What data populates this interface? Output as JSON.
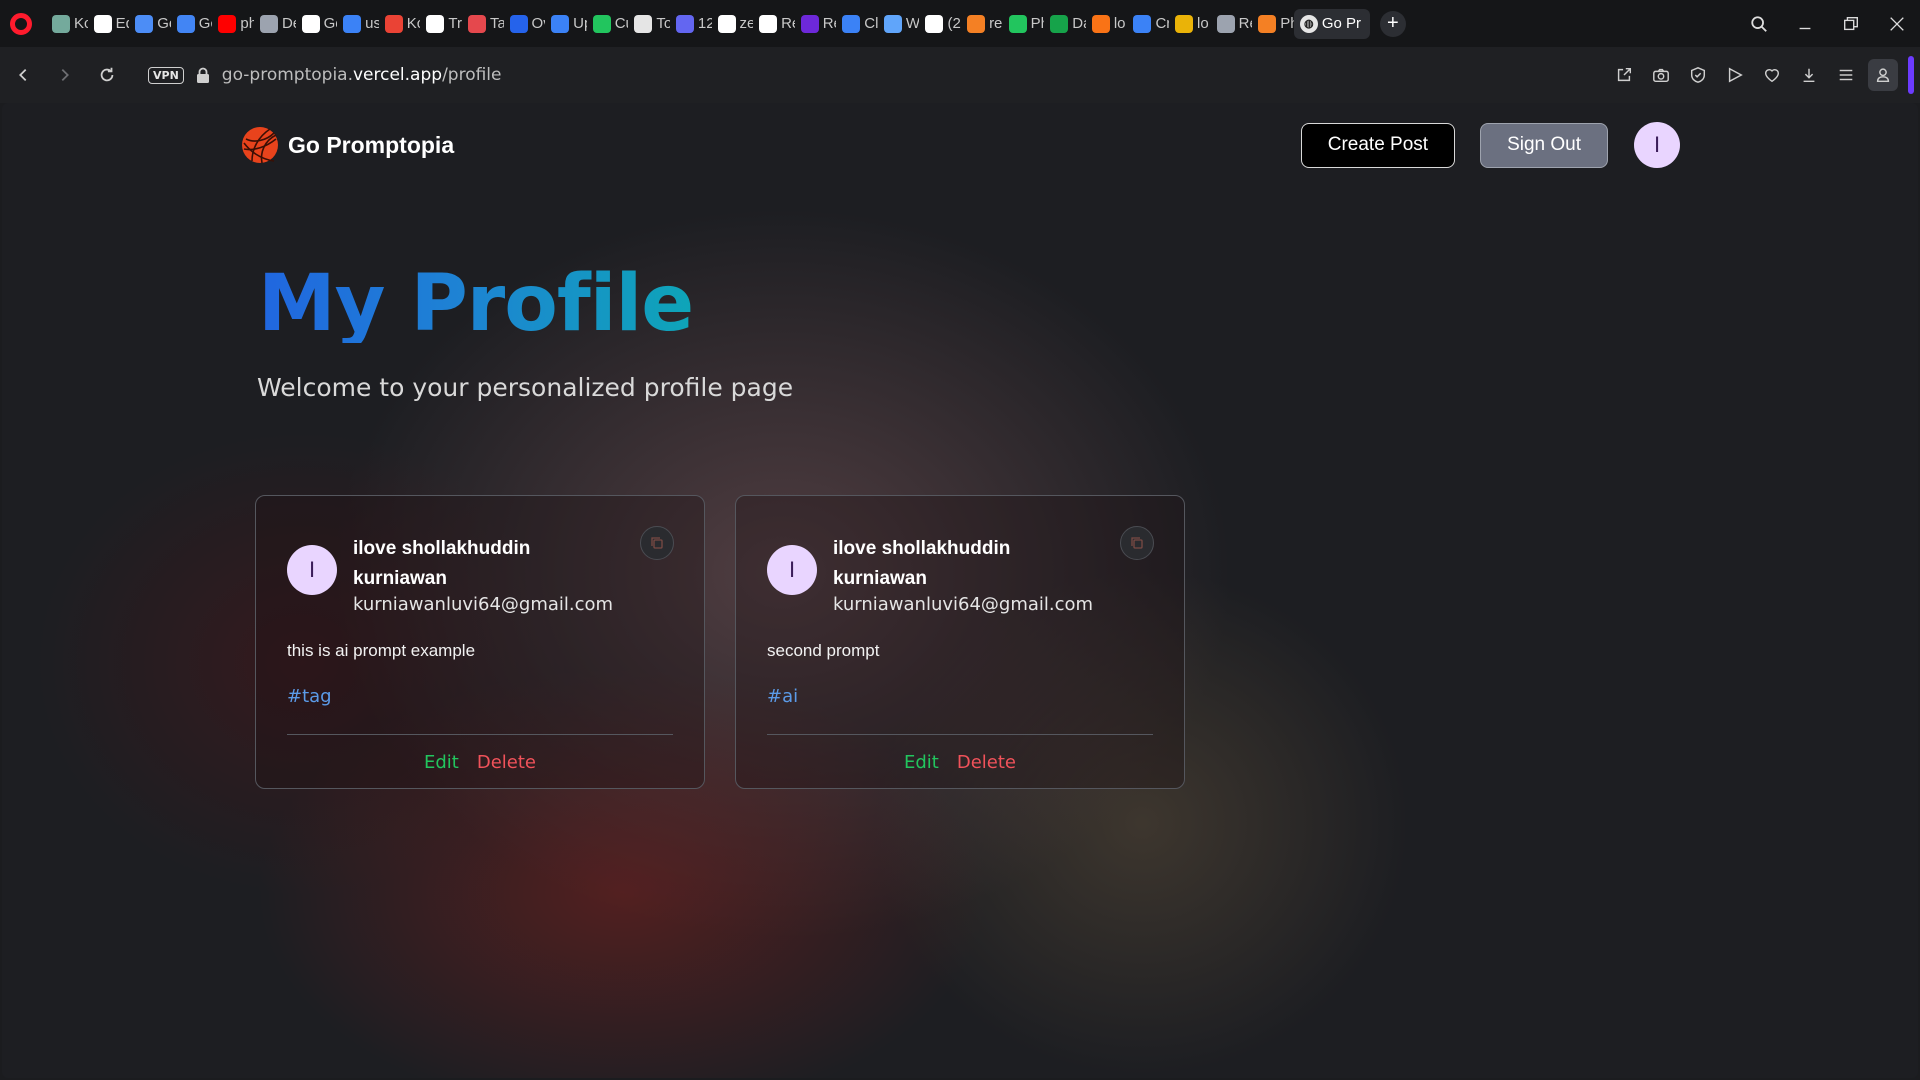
{
  "browser": {
    "tabs": [
      {
        "label": "Kc",
        "icon": "chatgpt-icon",
        "color": "#74aa9c"
      },
      {
        "label": "Ed",
        "icon": "github-icon",
        "color": "#ffffff"
      },
      {
        "label": "Ge",
        "icon": "gemini-icon",
        "color": "#4c8df6"
      },
      {
        "label": "Gc",
        "icon": "google-translate-icon",
        "color": "#4285f4"
      },
      {
        "label": "ph",
        "icon": "youtube-icon",
        "color": "#ff0000"
      },
      {
        "label": "De",
        "icon": "dev-avatar-icon",
        "color": "#9ca3af"
      },
      {
        "label": "Ge",
        "icon": "notion-n-icon",
        "color": "#ffffff"
      },
      {
        "label": "us",
        "icon": "openai-icon",
        "color": "#3b82f6"
      },
      {
        "label": "Kc",
        "icon": "gmail-icon",
        "color": "#ea4335"
      },
      {
        "label": "Tr",
        "icon": "framer-icon",
        "color": "#ffffff"
      },
      {
        "label": "Ta",
        "icon": "t-icon",
        "color": "#e5484d"
      },
      {
        "label": "Ov",
        "icon": "shield-icon",
        "color": "#2563eb"
      },
      {
        "label": "Up",
        "icon": "upwork-icon",
        "color": "#3b82f6"
      },
      {
        "label": "Cu",
        "icon": "copilot-icon",
        "color": "#22c55e"
      },
      {
        "label": "To",
        "icon": "pin-icon",
        "color": "#e5e5e5"
      },
      {
        "label": "12",
        "icon": "globe-icon",
        "color": "#6366f1"
      },
      {
        "label": "ze",
        "icon": "github-icon",
        "color": "#ffffff"
      },
      {
        "label": "Re",
        "icon": "react-icon",
        "color": "#ffffff"
      },
      {
        "label": "Re",
        "icon": "ryu-icon",
        "color": "#6d28d9"
      },
      {
        "label": "Cl",
        "icon": "cloud-icon",
        "color": "#3b82f6"
      },
      {
        "label": "W",
        "icon": "check-icon",
        "color": "#60a5fa"
      },
      {
        "label": "(2",
        "icon": "notion-icon",
        "color": "#ffffff"
      },
      {
        "label": "re",
        "icon": "stack-icon",
        "color": "#f48024"
      },
      {
        "label": "Ph",
        "icon": "w-icon",
        "color": "#22c55e"
      },
      {
        "label": "Da",
        "icon": "mongodb-icon",
        "color": "#16a34a"
      },
      {
        "label": "lo",
        "icon": "box-icon",
        "color": "#f97316"
      },
      {
        "label": "Cr",
        "icon": "api-icon",
        "color": "#3b82f6"
      },
      {
        "label": "lo",
        "icon": "mountain-icon",
        "color": "#eab308"
      },
      {
        "label": "Re",
        "icon": "book-icon",
        "color": "#9ca3af"
      },
      {
        "label": "Ph",
        "icon": "stack-icon",
        "color": "#f48024"
      }
    ],
    "active_tab": {
      "label": "Go Pr",
      "icon": "globe-icon"
    },
    "url_host": "go-promptopia.",
    "url_domain": "vercel.app",
    "url_path": "/profile",
    "vpn_label": "VPN"
  },
  "nav": {
    "brand": "Go Promptopia",
    "create_label": "Create Post",
    "signout_label": "Sign Out",
    "avatar_initial": "I"
  },
  "page": {
    "title": "My Profile",
    "subtitle": "Welcome to your personalized profile page"
  },
  "posts": [
    {
      "avatar_initial": "I",
      "name": "ilove shollakhuddin kurniawan",
      "email": "kurniawanluvi64@gmail.com",
      "prompt": "this is ai prompt example",
      "tag": "#tag",
      "edit_label": "Edit",
      "delete_label": "Delete"
    },
    {
      "avatar_initial": "I",
      "name": "ilove shollakhuddin kurniawan",
      "email": "kurniawanluvi64@gmail.com",
      "prompt": "second prompt",
      "tag": "#ai",
      "edit_label": "Edit",
      "delete_label": "Delete"
    }
  ],
  "colors": {
    "accent_title_start": "#2066e0",
    "accent_title_end": "#0ea5b8",
    "edit": "#22c55e",
    "delete": "#f0525a",
    "tag": "#5b9be8",
    "avatar_bg": "#e9d5ff"
  }
}
